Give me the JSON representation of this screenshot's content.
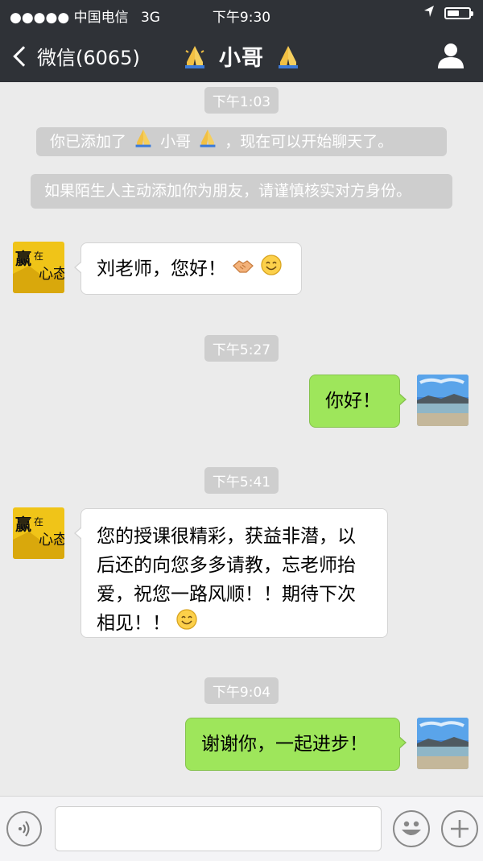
{
  "status_bar": {
    "signal": "●●●●● 中国电信",
    "network": "3G",
    "time": "下午9:30"
  },
  "nav": {
    "back_label": "微信(6065)",
    "title": "小哥"
  },
  "messages": {
    "ts1": "下午1:03",
    "sys1_a": "你已添加了",
    "sys1_name": "小哥",
    "sys1_b": "，现在可以开始聊天了。",
    "sys2": "如果陌生人主动添加你为朋友，请谨慎核实对方身份。",
    "msg1": "刘老师，您好！",
    "ts2": "下午5:27",
    "msg2": "你好！",
    "ts3": "下午5:41",
    "msg3": "您的授课很精彩，获益非潜，以后还的向您多多请教，忘老师抬爱，祝您一路风顺！！期待下次相见！！",
    "ts4": "下午9:04",
    "msg4": "谢谢你，一起进步！"
  },
  "input": {
    "placeholder": ""
  },
  "colors": {
    "header_bg": "#2f3237",
    "chat_bg": "#ebebeb",
    "sent_bubble": "#9ee65b",
    "received_bubble": "#ffffff"
  }
}
